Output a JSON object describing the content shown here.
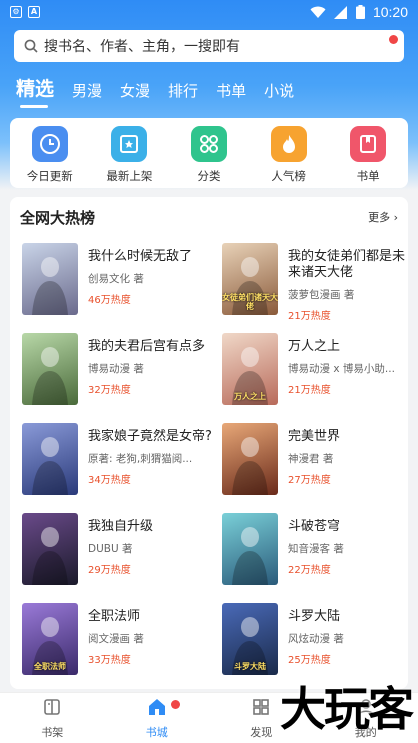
{
  "status_bar": {
    "time": "10:20"
  },
  "search": {
    "placeholder": "搜书名、作者、主角，一搜即有"
  },
  "tabs": [
    "精选",
    "男漫",
    "女漫",
    "排行",
    "书单",
    "小说"
  ],
  "categories": [
    {
      "label": "今日更新",
      "icon": "clock-icon",
      "color": "#4a8ef0"
    },
    {
      "label": "最新上架",
      "icon": "new-shelf-icon",
      "color": "#3bb0e8"
    },
    {
      "label": "分类",
      "icon": "grid-icon",
      "color": "#2fc48d"
    },
    {
      "label": "人气榜",
      "icon": "flame-icon",
      "color": "#f7a330"
    },
    {
      "label": "书单",
      "icon": "booklist-icon",
      "color": "#f0566a"
    }
  ],
  "ranking": {
    "title": "全网大热榜",
    "more": "更多",
    "books": [
      {
        "title": "我什么时候无敌了",
        "author": "创易文化 著",
        "heat": "46万热度",
        "cover_colors": [
          "#c9d4e8",
          "#6a6a8c"
        ],
        "cover_art": ""
      },
      {
        "title": "我的女徒弟们都是未来诸天大佬",
        "author": "菠萝包漫画 著",
        "heat": "21万热度",
        "cover_colors": [
          "#e8d2b8",
          "#8a5a3a"
        ],
        "cover_art": "女徒弟们诸天大佬"
      },
      {
        "title": "我的夫君后宫有点多",
        "author": "博易动漫 著",
        "heat": "32万热度",
        "cover_colors": [
          "#b8d8a8",
          "#4a6a3a"
        ],
        "cover_art": ""
      },
      {
        "title": "万人之上",
        "author": "博易动漫 x 博易小助...",
        "heat": "21万热度",
        "cover_colors": [
          "#f0d8c8",
          "#b86a5a"
        ],
        "cover_art": "万人之上"
      },
      {
        "title": "我家娘子竟然是女帝?",
        "author": "原著: 老狗,刺猬猫阅...",
        "heat": "34万热度",
        "cover_colors": [
          "#8a9ad8",
          "#2a3a7a"
        ],
        "cover_art": ""
      },
      {
        "title": "完美世界",
        "author": "神漫君 著",
        "heat": "27万热度",
        "cover_colors": [
          "#e8a878",
          "#6a2a1a"
        ],
        "cover_art": ""
      },
      {
        "title": "我独自升级",
        "author": "DUBU 著",
        "heat": "29万热度",
        "cover_colors": [
          "#6a4a8a",
          "#1a1a2a"
        ],
        "cover_art": ""
      },
      {
        "title": "斗破苍穹",
        "author": "知音漫客 著",
        "heat": "22万热度",
        "cover_colors": [
          "#7ad0d8",
          "#2a5a7a"
        ],
        "cover_art": ""
      },
      {
        "title": "全职法师",
        "author": "阅文漫画 著",
        "heat": "33万热度",
        "cover_colors": [
          "#9a7ad8",
          "#3a2a6a"
        ],
        "cover_art": "全职法师"
      },
      {
        "title": "斗罗大陆",
        "author": "风炫动漫 著",
        "heat": "25万热度",
        "cover_colors": [
          "#4a6ab8",
          "#1a2a4a"
        ],
        "cover_art": "斗罗大陆"
      }
    ]
  },
  "bottom_nav": [
    {
      "label": "书架",
      "icon": "bookshelf-icon",
      "active": false
    },
    {
      "label": "书城",
      "icon": "home-icon",
      "active": true
    },
    {
      "label": "发现",
      "icon": "discover-icon",
      "active": false
    },
    {
      "label": "我的",
      "icon": "profile-icon",
      "active": false
    }
  ],
  "watermark": "大玩客",
  "colors": {
    "accent": "#2f8cf5",
    "heat": "#e8502c",
    "badge": "#f04646"
  }
}
